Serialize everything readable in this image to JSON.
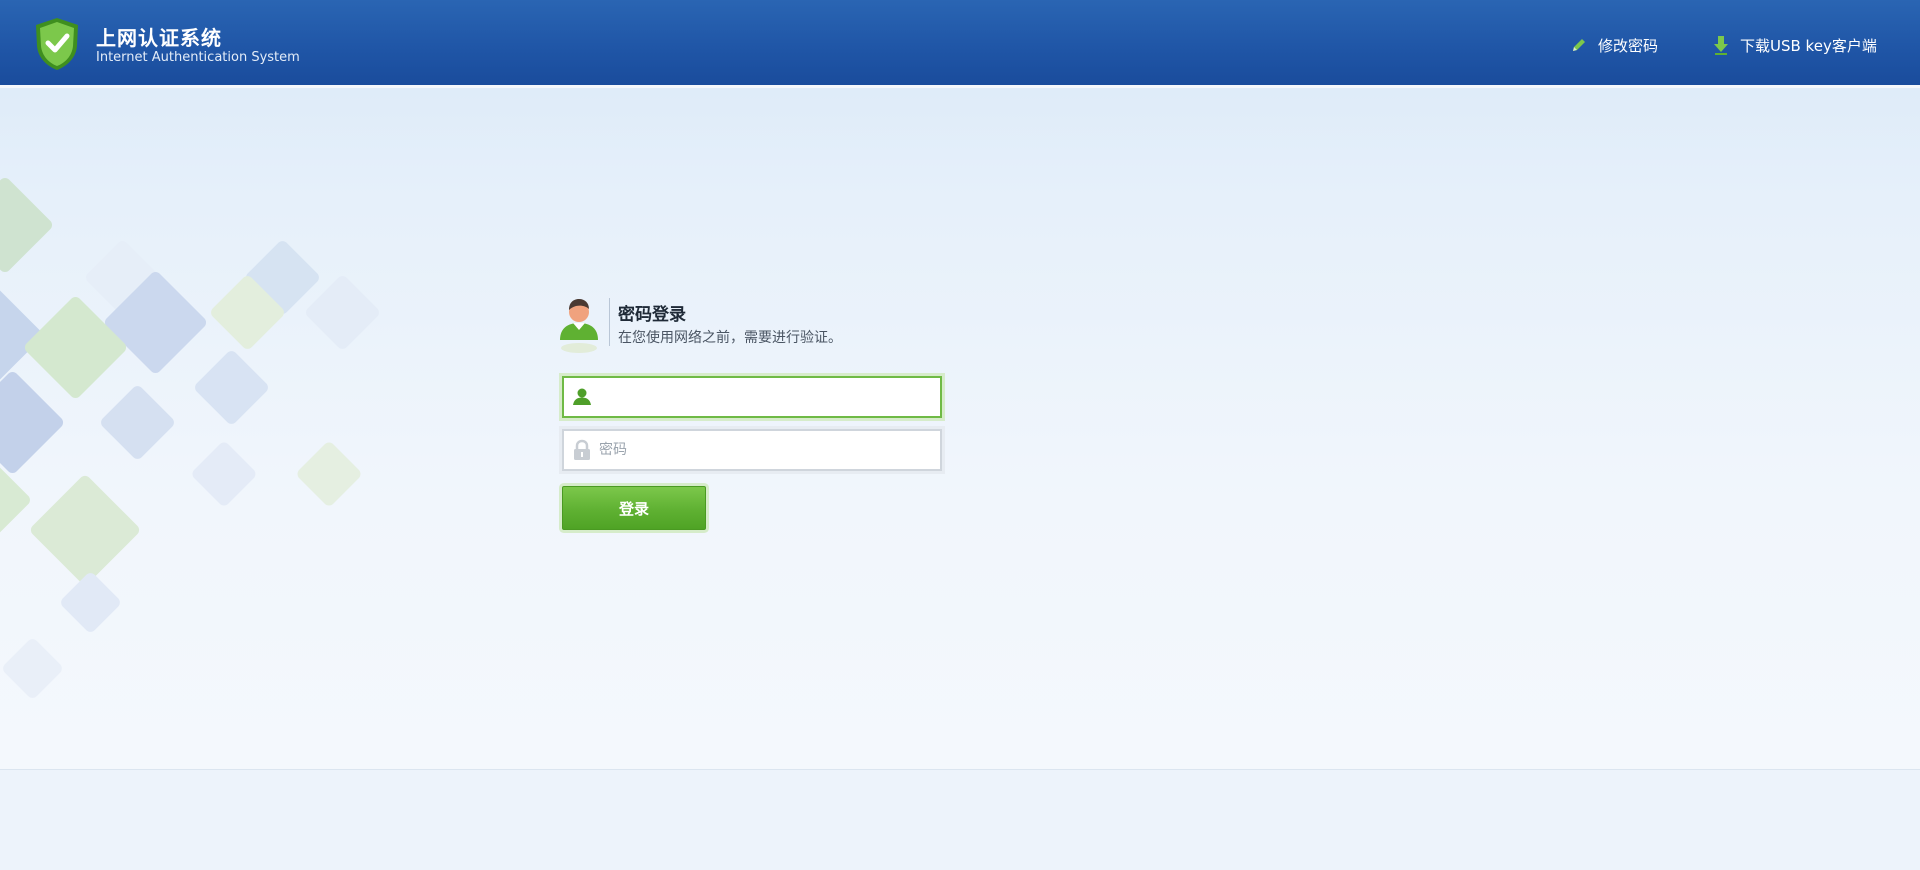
{
  "header": {
    "title": "上网认证系统",
    "subtitle": "Internet Authentication System",
    "links": {
      "change_password": "修改密码",
      "download_client": "下载USB key客户端"
    }
  },
  "login": {
    "title": "密码登录",
    "description": "在您使用网络之前，需要进行验证。",
    "username_value": "",
    "password_placeholder": "密码",
    "submit_label": "登录"
  },
  "colors": {
    "header_blue": "#1f55a6",
    "accent_green": "#5fb132"
  },
  "icons": {
    "logo": "shield-check-icon",
    "change_password": "pencil-icon",
    "download": "download-arrow-icon",
    "username_field": "user-icon",
    "password_field": "lock-icon",
    "avatar": "user-avatar-icon"
  }
}
